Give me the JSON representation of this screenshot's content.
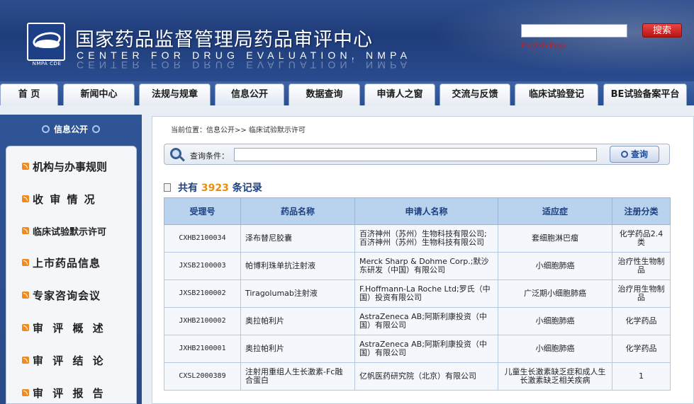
{
  "header": {
    "title_cn": "国家药品监督管理局药品审评中心",
    "title_en": "CENTER FOR DRUG EVALUATION, NMPA",
    "logo_caption": "NMPA CDE",
    "search_button": "搜索",
    "english_link": "English Page",
    "search_value": ""
  },
  "nav": {
    "items": [
      {
        "label": "首  页"
      },
      {
        "label": "新闻中心"
      },
      {
        "label": "法规与规章"
      },
      {
        "label": "信息公开"
      },
      {
        "label": "数据查询"
      },
      {
        "label": "申请人之窗"
      },
      {
        "label": "交流与反馈"
      },
      {
        "label": "临床试验登记"
      },
      {
        "label": "BE试验备案平台"
      }
    ],
    "active": "信息公开"
  },
  "sidebar": {
    "title": "信息公开",
    "items": [
      {
        "label": "机构与办事规则"
      },
      {
        "label": "收 审 情 况"
      },
      {
        "label": "临床试验默示许可"
      },
      {
        "label": "上市药品信息"
      },
      {
        "label": "专家咨询会议"
      },
      {
        "label": "审 评 概 述"
      },
      {
        "label": "审 评 结 论"
      },
      {
        "label": "审 评 报 告"
      }
    ]
  },
  "main": {
    "breadcrumb": "当前位置：信息公开>> 临床试验默示许可",
    "query_label": "查询条件：",
    "query_value": "",
    "query_button": "查询",
    "count_prefix": "共有",
    "count": "3923",
    "count_suffix": "条记录",
    "table": {
      "headers": [
        "受理号",
        "药品名称",
        "申请人名称",
        "适应症",
        "注册分类"
      ],
      "rows": [
        {
          "id": "CXHB2100034",
          "drug": "泽布替尼胶囊",
          "applicant": "百济神州（苏州）生物科技有限公司;百济神州（苏州）生物科技有限公司",
          "indication": "套细胞淋巴瘤",
          "category": "化学药品2.4类"
        },
        {
          "id": "JXSB2100003",
          "drug": "帕博利珠单抗注射液",
          "applicant": "Merck Sharp & Dohme Corp.;默沙东研发（中国）有限公司",
          "indication": "小细胞肺癌",
          "category": "治疗性生物制品"
        },
        {
          "id": "JXSB2100002",
          "drug": "Tiragolumab注射液",
          "applicant": "F.Hoffmann-La Roche Ltd;罗氏（中国）投资有限公司",
          "indication": "广泛期小细胞肺癌",
          "category": "治疗用生物制品"
        },
        {
          "id": "JXHB2100002",
          "drug": "奥拉帕利片",
          "applicant": "AstraZeneca AB;阿斯利康投资（中国）有限公司",
          "indication": "小细胞肺癌",
          "category": "化学药品"
        },
        {
          "id": "JXHB2100001",
          "drug": "奥拉帕利片",
          "applicant": "AstraZeneca AB;阿斯利康投资（中国）有限公司",
          "indication": "小细胞肺癌",
          "category": "化学药品"
        },
        {
          "id": "CXSL2000389",
          "drug": "注射用重组人生长激素-Fc融合蛋白",
          "applicant": "亿帆医药研究院（北京）有限公司",
          "indication": "儿童生长激素缺乏症和成人生长激素缺乏相关疾病",
          "category": "1"
        }
      ]
    }
  }
}
